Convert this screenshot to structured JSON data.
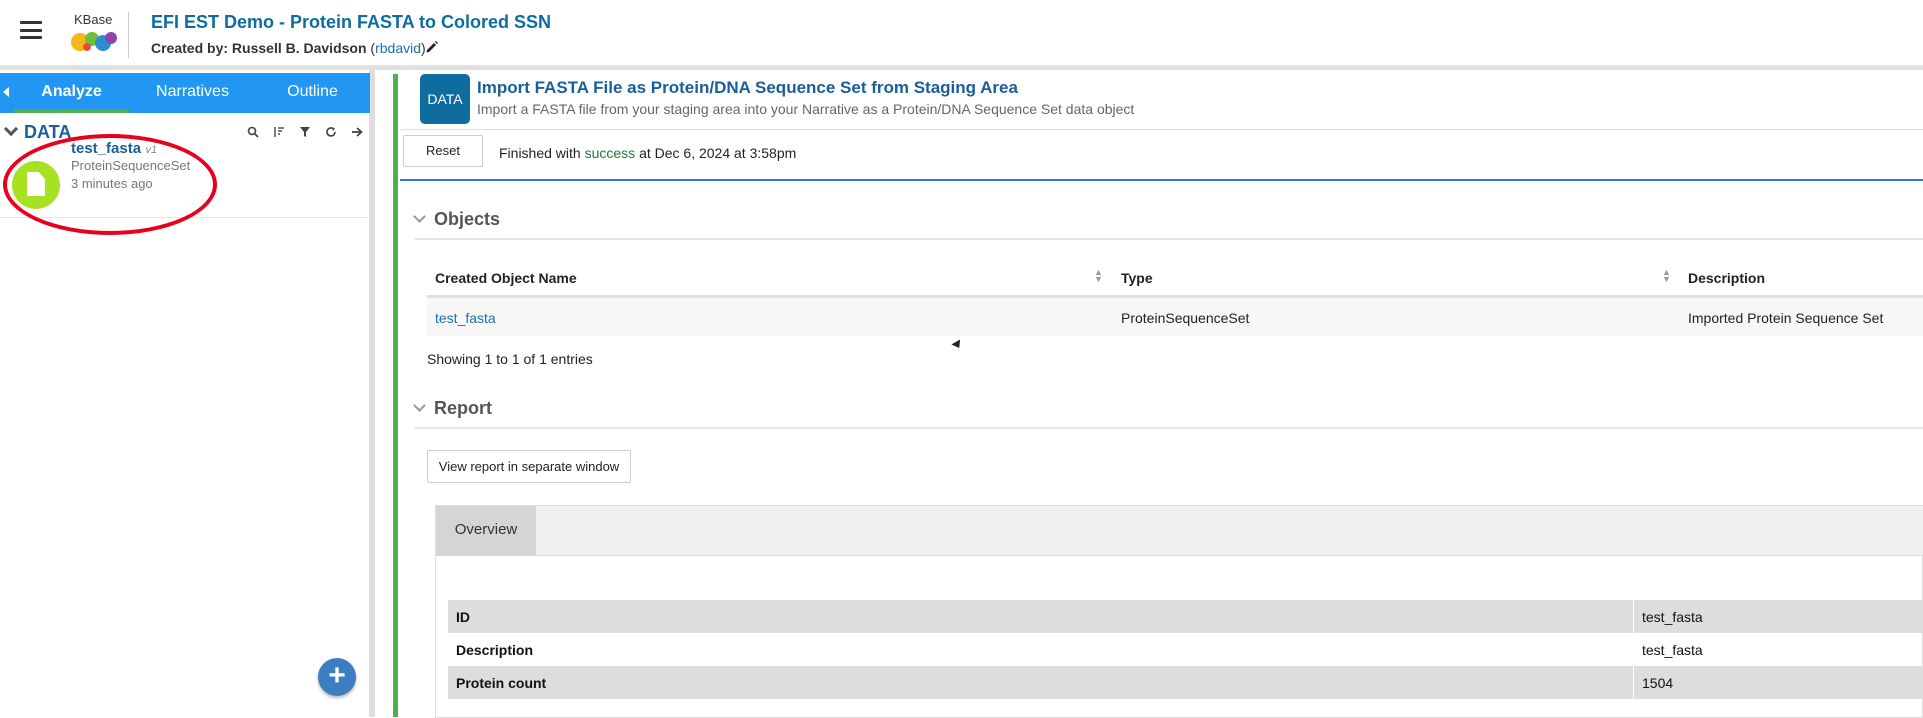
{
  "header": {
    "logo_text": "KBase",
    "title": "EFI EST Demo - Protein FASTA to Colored SSN",
    "created_by_label": "Created by:",
    "creator_name": "Russell B. Davidson",
    "creator_open": "(",
    "creator_id": "rbdavid",
    "creator_close": ")"
  },
  "sidepanel": {
    "tabs": [
      "Analyze",
      "Narratives",
      "Outline"
    ],
    "data_title": "DATA",
    "item": {
      "name": "test_fasta",
      "version": "v1",
      "type": "ProteinSequenceSet",
      "time": "3 minutes ago"
    }
  },
  "cell": {
    "badge": "DATA",
    "title": "Import FASTA File as Protein/DNA Sequence Set from Staging Area",
    "subtitle": "Import a FASTA file from your staging area into your Narrative as a Protein/DNA Sequence Set data object",
    "reset_label": "Reset",
    "status_prefix": "Finished with",
    "status_word": "success",
    "status_suffix": "at Dec 6, 2024 at 3:58pm"
  },
  "objects": {
    "section_title": "Objects",
    "columns": [
      "Created Object Name",
      "Type",
      "Description"
    ],
    "rows": [
      [
        "test_fasta",
        "ProteinSequenceSet",
        "Imported Protein Sequence Set"
      ]
    ],
    "showing": "Showing 1 to 1 of 1 entries"
  },
  "report": {
    "section_title": "Report",
    "view_button": "View report in separate window",
    "tab": "Overview",
    "rows": [
      {
        "key": "ID",
        "value": "test_fasta"
      },
      {
        "key": "Description",
        "value": "test_fasta"
      },
      {
        "key": "Protein count",
        "value": "1504"
      }
    ]
  },
  "colors": {
    "accent": "#2196f3",
    "title": "#1a5e9a",
    "success": "#1f7a3a",
    "annotation": "#e8001c"
  }
}
